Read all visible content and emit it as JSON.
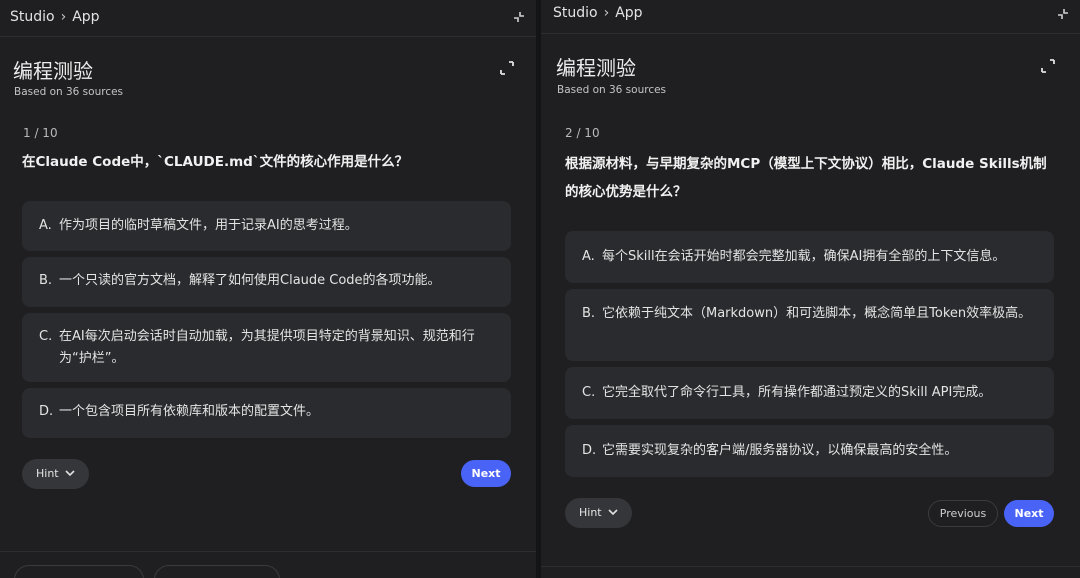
{
  "panels": [
    {
      "breadcrumb": [
        "Studio",
        "App"
      ],
      "title": "编程测验",
      "subtitle": "Based on 36 sources",
      "counter": "1 / 10",
      "question": "在Claude Code中，`CLAUDE.md`文件的核心作用是什么？",
      "options": [
        {
          "letter": "A.",
          "text": "作为项目的临时草稿文件，用于记录AI的思考过程。"
        },
        {
          "letter": "B.",
          "text": "一个只读的官方文档，解释了如何使用Claude Code的各项功能。"
        },
        {
          "letter": "C.",
          "text": "在AI每次启动会话时自动加载，为其提供项目特定的背景知识、规范和行为“护栏”。"
        },
        {
          "letter": "D.",
          "text": "一个包含项目所有依赖库和版本的配置文件。"
        }
      ],
      "hint_label": "Hint",
      "next_label": "Next"
    },
    {
      "breadcrumb": [
        "Studio",
        "App"
      ],
      "title": "编程测验",
      "subtitle": "Based on 36 sources",
      "counter": "2 / 10",
      "question": "根据源材料，与早期复杂的MCP（模型上下文协议）相比，Claude Skills机制的核心优势是什么？",
      "options": [
        {
          "letter": "A.",
          "text": "每个Skill在会话开始时都会完整加载，确保AI拥有全部的上下文信息。"
        },
        {
          "letter": "B.",
          "text": "它依赖于纯文本（Markdown）和可选脚本，概念简单且Token效率极高。"
        },
        {
          "letter": "C.",
          "text": "它完全取代了命令行工具，所有操作都通过预定义的Skill API完成。"
        },
        {
          "letter": "D.",
          "text": "它需要实现复杂的客户端/服务器协议，以确保最高的安全性。"
        }
      ],
      "hint_label": "Hint",
      "previous_label": "Previous",
      "next_label": "Next"
    }
  ],
  "colors": {
    "panel_bg": "#1f1f21",
    "option_bg": "#2a2b2e",
    "accent": "#4a63f7"
  }
}
